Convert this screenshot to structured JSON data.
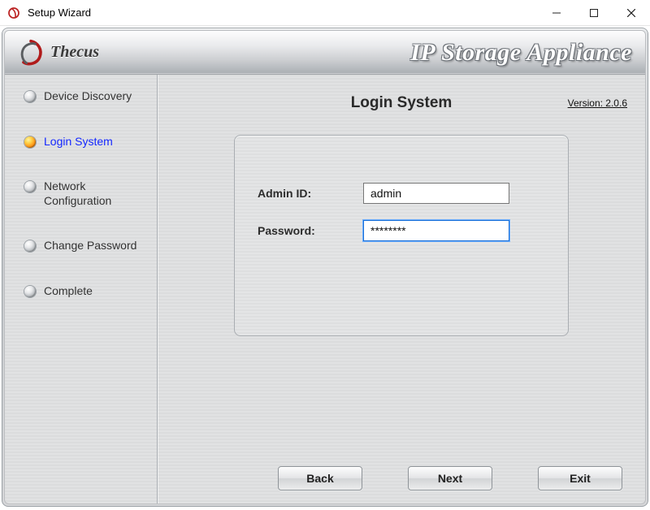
{
  "window": {
    "title": "Setup Wizard"
  },
  "brand": {
    "logo_text": "Thecus"
  },
  "banner": {
    "product_title": "IP Storage Appliance"
  },
  "version": {
    "label": "Version: 2.0.6"
  },
  "sidebar": {
    "steps": [
      {
        "label": "Device Discovery",
        "active": false
      },
      {
        "label": "Login System",
        "active": true
      },
      {
        "label": "Network Configuration",
        "active": false
      },
      {
        "label": "Change Password",
        "active": false
      },
      {
        "label": "Complete",
        "active": false
      }
    ]
  },
  "page": {
    "heading": "Login System",
    "admin_id_label": "Admin ID:",
    "admin_id_value": "admin",
    "password_label": "Password:",
    "password_value": "********"
  },
  "buttons": {
    "back": "Back",
    "next": "Next",
    "exit": "Exit"
  }
}
